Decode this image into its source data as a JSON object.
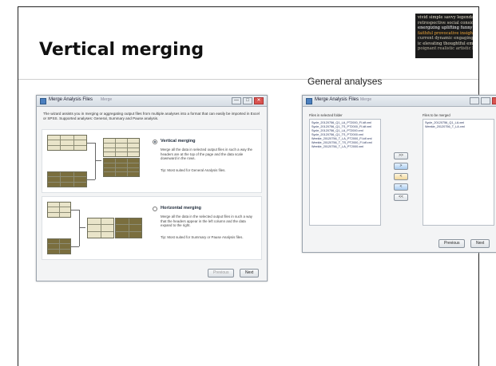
{
  "slide": {
    "title": "Vertical merging",
    "caption": "General analyses",
    "logo_words": [
      {
        "text": "vivid simple savvy legendary bright",
        "color": "#e8e2d0"
      },
      {
        "text": "retrospective social considerate",
        "color": "#d9d3c1"
      },
      {
        "text": "energizing uplifting funny shared",
        "color": "#ffffff"
      },
      {
        "text": "faithful provocative insightful",
        "color": "#f2a93b"
      },
      {
        "text": "current dynamic engaging tastefu",
        "color": "#cfc9b6"
      },
      {
        "text": "ic elevating thoughtful eminent",
        "color": "#e0dac8"
      },
      {
        "text": "poignant realistic artistic heartfelt",
        "color": "#b9b3a1"
      }
    ]
  },
  "wizard_left": {
    "title": "Merge Analysis Files",
    "title_suffix": "Merge",
    "controls": [
      "—",
      "□",
      "✕"
    ],
    "intro": "The wizard assists you in merging or aggregating output files from multiple analyses into a format that can easily be imported in Excel or SPSS. Supported analyses: General, Summary and Pause analysis.",
    "vertical": {
      "label": "Vertical merging",
      "desc": "Merge all the data in selected output files in such a way the headers are at the top of the page and the data scale downward in the rows.",
      "tip": "Tip: Most suited for General Analysis files.",
      "selected": true
    },
    "horizontal": {
      "label": "Horizontal merging",
      "desc": "Merge all the data in the selected output files in such a way that the headers appear in the left column and the data expand to the right.",
      "tip": "Tip: Most suited for Summary or Pause Analysis files.",
      "selected": false
    },
    "previous_label": "Previous",
    "next_label": "Next"
  },
  "wizard_right": {
    "title": "Merge Analysis Files",
    "title_suffix": "Merge",
    "left_list_label": "Files in selected folder",
    "left_list": [
      "Sycle_20120756_Q1_LA_PT2000_Fl.idf.xml",
      "Sycle_20120756_Q1_TS_PT2000_Fl.idf.xml",
      "Sycle_20120756_Q1_LA_PT2000.xml",
      "Sycle_20120756_Q1_TS_PT2000.xml",
      "Weekle_20120756_T_LA_PT2000_Fl.idf.xml",
      "Weekle_20120756_T_TS_PT2000_Fl.idf.xml",
      "Weekle_20120756_T_LA_PT2000.xml"
    ],
    "right_list_label": "Files to be merged",
    "right_list": [
      "Sycle_20120756_Q1_LA.xml",
      "Weekle_20120756_T_LA.xml"
    ],
    "move_buttons": [
      ">>",
      ">",
      "<",
      "<",
      "<<"
    ],
    "previous_label": "Previous",
    "next_label": "Next"
  }
}
